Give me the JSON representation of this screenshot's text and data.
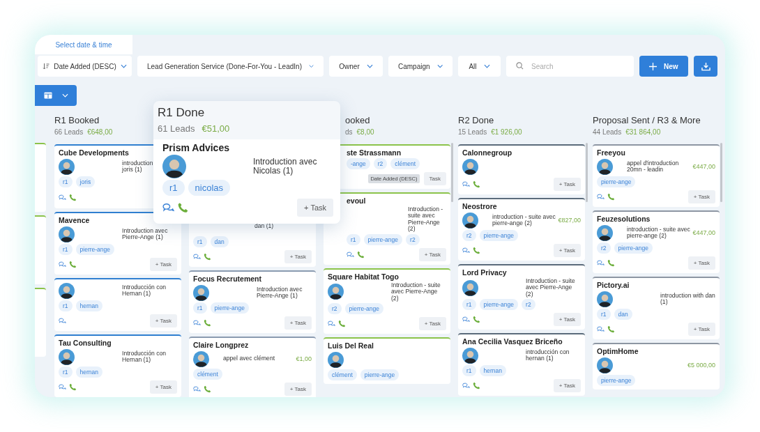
{
  "tab": {
    "label": "Select date & time"
  },
  "toolbar": {
    "sort": {
      "label": "Date Added (DESC)"
    },
    "filters": [
      "Lead Generation Service (Done-For-You - LeadIn)",
      "Owner",
      "Campaign",
      "All"
    ],
    "search": {
      "placeholder": "Search"
    },
    "new_button": "New"
  },
  "columns": [
    {
      "kind": "sliver",
      "color": "#8bc34a",
      "cards": [
        {
          "kind": "blank"
        },
        {
          "kind": "blank"
        },
        {
          "kind": "blank"
        }
      ]
    },
    {
      "kind": "full",
      "title": "R1 Booked",
      "count": "66 Leads",
      "amount": "€648,00",
      "color": "#2f7fd0",
      "cards": [
        {
          "kind": "clipped",
          "name": "Cube Developments",
          "note": "introduction joris (1)",
          "tags": [
            "r1",
            "joris"
          ],
          "chat": true,
          "phone": true
        },
        {
          "kind": "normal",
          "name": "Mavence",
          "note": "Introduction avec Pierre-Ange (1)",
          "tags": [
            "r1",
            "pierre-ange"
          ],
          "chat": true,
          "phone": true,
          "task": "+ Task"
        },
        {
          "kind": "normal",
          "note": "Introducción con Hernan (1)",
          "tags": [
            "r1",
            "hernan"
          ],
          "chat": true,
          "phone": false,
          "task": "+ Task"
        },
        {
          "kind": "normal",
          "name": "Tau Consulting",
          "note": "Introducción con Hernan (1)",
          "tags": [
            "r1",
            "hernan"
          ],
          "chat": true,
          "phone": true,
          "task": "+ Task"
        }
      ]
    },
    {
      "kind": "hidden",
      "color": "#8a9bb0",
      "cards": [
        {
          "kind": "covered",
          "note": "dan (1)",
          "tags": [
            "r1",
            "dan"
          ],
          "chat": true,
          "phone": true,
          "task": "+ Task"
        },
        {
          "kind": "normal",
          "name": "Focus Recrutement",
          "note": "Introduction avec Pierre-Ange (1)",
          "tags": [
            "r1",
            "pierre-ange"
          ],
          "chat": true,
          "phone": true,
          "task": "+ Task"
        },
        {
          "kind": "normal",
          "name": "Claire Longprez",
          "note": "appel avec clément",
          "amount": "€1,00",
          "tags": [
            "clément"
          ],
          "chat": true,
          "phone": true,
          "task": "+ Task"
        }
      ]
    },
    {
      "kind": "partial",
      "title": "ooked",
      "count": "ds",
      "amount": "€8,00",
      "color": "#8bc34a",
      "cards": [
        {
          "kind": "partial",
          "name": "ste Strassmann",
          "tags": [
            "-ange",
            "r2",
            "clément"
          ],
          "chat": false,
          "phone": false,
          "tooltip": "Date Added (DESC)",
          "task": "Task"
        },
        {
          "kind": "partial",
          "name": "evoul",
          "note": "Introduction - suite avec Pierre-Ange (2)",
          "tags": [
            "r1",
            "pierre-ange",
            "r2"
          ],
          "chat": true,
          "phone": true,
          "task": "+ Task"
        },
        {
          "kind": "normal",
          "name": "Square Habitat Togo",
          "note": "Introduction - suite avec Pierre-Ange (2)",
          "tags": [
            "r2",
            "pierre-ange"
          ],
          "chat": true,
          "phone": true,
          "task": "+ Task"
        },
        {
          "kind": "normal",
          "name": "Luis Del Real",
          "tags": [
            "clément",
            "pierre-ange"
          ]
        }
      ]
    },
    {
      "kind": "full",
      "title": "R2 Done",
      "count": "15 Leads",
      "amount": "€1 926,00",
      "color": "#5b6b7b",
      "cards": [
        {
          "kind": "normal",
          "name": "Calonnegroup",
          "chat": true,
          "phone": true,
          "task": "+ Task"
        },
        {
          "kind": "normal",
          "name": "Neostrore",
          "note": "introduction - suite avec pierre-ange (2)",
          "amount": "€827,00",
          "tags": [
            "r2",
            "pierre-ange"
          ],
          "chat": true,
          "phone": true,
          "task": "+ Task"
        },
        {
          "kind": "normal",
          "name": "Lord Privacy",
          "note": "Introduction - suite avec Pierre-Ange (2)",
          "tags": [
            "r1",
            "pierre-ange",
            "r2"
          ],
          "chat": true,
          "phone": true,
          "task": "+ Task"
        },
        {
          "kind": "normal",
          "name": "Ana Cecilia Vasquez Briceño",
          "note": "introducción con hernan (1)",
          "tags": [
            "r1",
            "hernan"
          ],
          "chat": true,
          "phone": true,
          "task": "+ Task"
        }
      ]
    },
    {
      "kind": "full",
      "title": "Proposal Sent / R3 & More",
      "count": "44 Leads",
      "amount": "€31 864,00",
      "color": "#8d96a3",
      "cards": [
        {
          "kind": "normal",
          "name": "Freeyou",
          "note": "appel d'introduction 20mn - leadin",
          "amount": "€447,00",
          "tags": [
            "pierre-ange"
          ],
          "chat": true,
          "phone": true,
          "task": "+ Task"
        },
        {
          "kind": "normal",
          "name": "Feuzesolutions",
          "note": "introduction - suite avec pierre-ange (2)",
          "amount": "€447,00",
          "tags": [
            "r2",
            "pierre-ange"
          ],
          "chat": true,
          "phone": true,
          "task": "+ Task"
        },
        {
          "kind": "normal",
          "name": "Pictory.ai",
          "note": "introduction with dan (1)",
          "tags": [
            "r1",
            "dan"
          ],
          "chat": true,
          "phone": true,
          "task": "+ Task"
        },
        {
          "kind": "normal",
          "name": "OptimHome",
          "amount": "€5 000,00",
          "tags": [
            "pierre-ange"
          ]
        }
      ]
    }
  ],
  "dragged_card": {
    "column_title": "R1 Done",
    "count": "61 Leads",
    "amount": "€51,00",
    "name": "Prism Advices",
    "note": "Introduction avec Nicolas (1)",
    "tags": [
      "r1",
      "nicolas"
    ],
    "chat": true,
    "phone": true,
    "task": "+ Task"
  }
}
